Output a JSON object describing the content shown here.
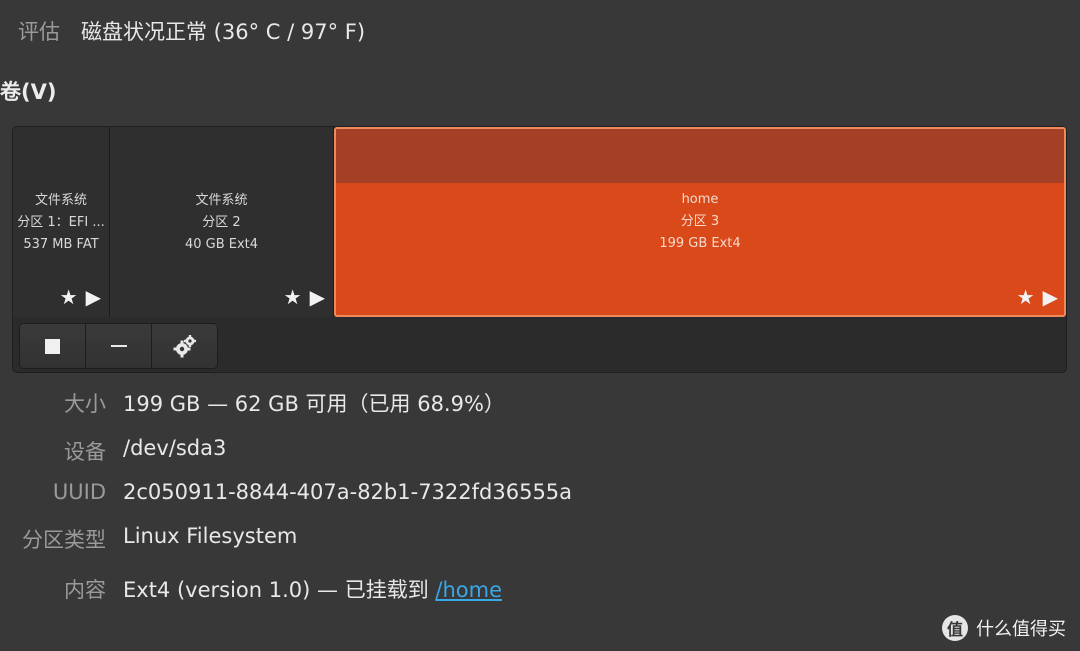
{
  "assessment": {
    "label": "评估",
    "value": "磁盘状况正常 (36° C / 97° F)"
  },
  "volumes": {
    "heading": "卷(V)",
    "partitions": [
      {
        "line1": "文件系统",
        "line2": "分区 1：EFI ...",
        "line3": "537 MB FAT"
      },
      {
        "line1": "文件系统",
        "line2": "分区 2",
        "line3": "40 GB Ext4"
      },
      {
        "line1": "home",
        "line2": "分区 3",
        "line3": "199 GB Ext4"
      }
    ],
    "toolbar": [
      "stop-icon",
      "minus-icon",
      "gears-icon"
    ]
  },
  "details": {
    "size": {
      "label": "大小",
      "value": "199 GB — 62 GB 可用（已用 68.9%）"
    },
    "device": {
      "label": "设备",
      "value": "/dev/sda3"
    },
    "uuid": {
      "label": "UUID",
      "value": "2c050911-8844-407a-82b1-7322fd36555a"
    },
    "partition_type": {
      "label": "分区类型",
      "value": "Linux Filesystem"
    },
    "contents": {
      "label": "内容",
      "value": "Ext4 (version 1.0) — 已挂载到 ",
      "mount_link": "/home"
    }
  },
  "watermark": {
    "text": "什么值得买",
    "logo": "值"
  },
  "colors": {
    "selected_partition": "#d9491a",
    "link": "#3aa7e6",
    "background": "#383838"
  }
}
